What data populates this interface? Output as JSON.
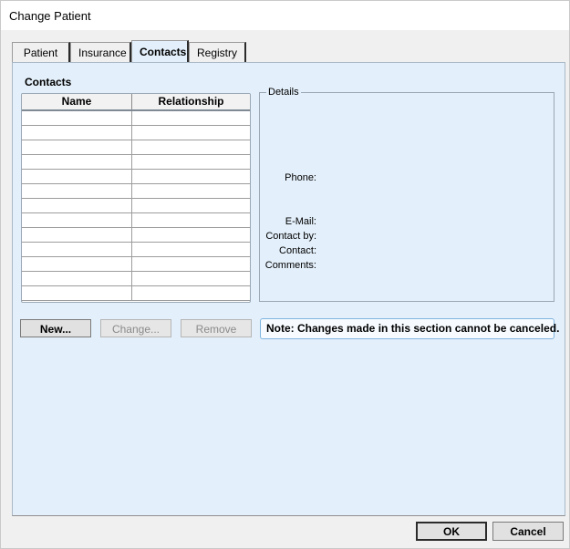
{
  "window": {
    "title": "Change Patient"
  },
  "tabs": [
    {
      "label": "Patient",
      "active": false
    },
    {
      "label": "Insurance",
      "active": false
    },
    {
      "label": "Contacts",
      "active": true
    },
    {
      "label": "Registry",
      "active": false
    }
  ],
  "contacts": {
    "heading": "Contacts",
    "columns": {
      "name": "Name",
      "relationship": "Relationship"
    },
    "rows": []
  },
  "details": {
    "legend": "Details",
    "labels": {
      "phone": "Phone:",
      "email": "E-Mail:",
      "contact_by": "Contact by:",
      "contact": "Contact:",
      "comments": "Comments:"
    }
  },
  "actions": {
    "new_label": "New...",
    "change_label": "Change...",
    "remove_label": "Remove"
  },
  "note": {
    "text": "Note:  Changes made in this section cannot be canceled."
  },
  "footer": {
    "ok_label": "OK",
    "cancel_label": "Cancel"
  },
  "colors": {
    "panel_background": "#e3effa",
    "note_border": "#7fb4e0"
  }
}
